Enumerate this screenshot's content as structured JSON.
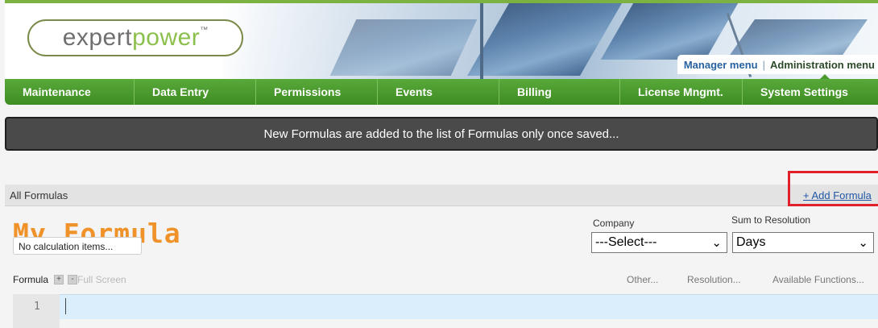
{
  "logo": {
    "part1": "expert",
    "part2": "power",
    "tm": "™"
  },
  "header_menus": {
    "manager": "Manager menu",
    "separator": "|",
    "admin": "Administration menu"
  },
  "nav": [
    "Maintenance",
    "Data Entry",
    "Permissions",
    "Events",
    "Billing",
    "License Mngmt.",
    "System Settings"
  ],
  "notice": "New Formulas are added to the list of Formulas only once saved...",
  "breadcrumb": "All Formulas",
  "add_formula": "+ Add Formula",
  "title": "My Formula",
  "no_calc": "No calculation items...",
  "company": {
    "label": "Company",
    "value": "---Select---"
  },
  "resolution": {
    "label": "Sum to Resolution",
    "value": "Days"
  },
  "toolbar": {
    "formula_label": "Formula",
    "plus": "+",
    "minus": "-",
    "full_screen": "Full Screen",
    "other": "Other...",
    "resolution": "Resolution...",
    "functions": "Available Functions..."
  },
  "editor": {
    "line_number": "1"
  },
  "colors": {
    "nav_green": "#4e9b2d",
    "title_orange": "#f0922a",
    "link_blue": "#2156a5",
    "highlight_red": "#e0202a"
  }
}
